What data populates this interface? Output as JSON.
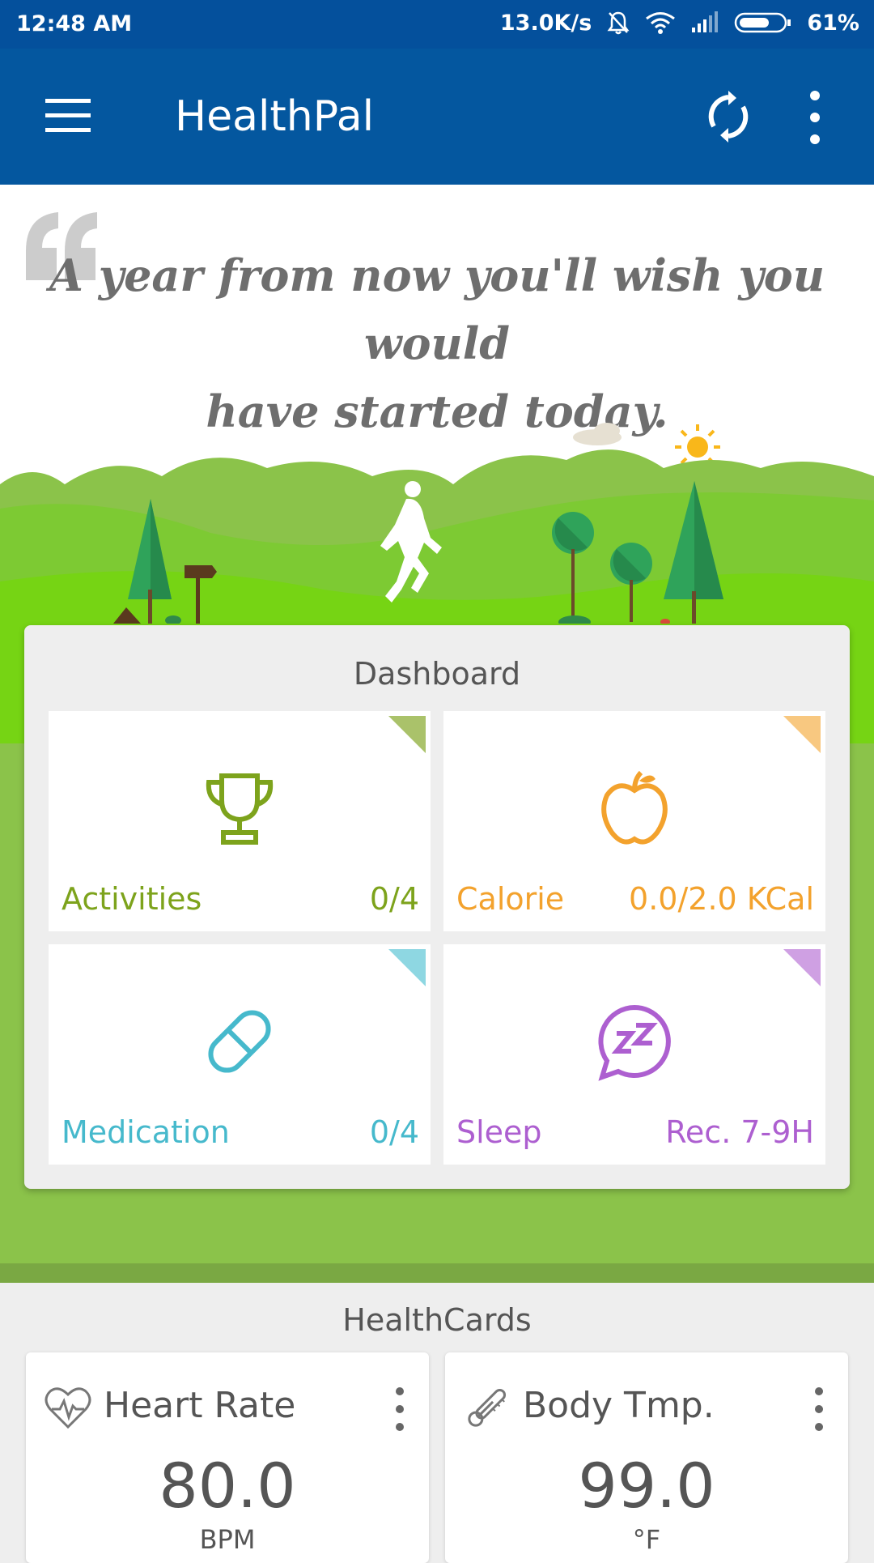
{
  "status_bar": {
    "time": "12:48 AM",
    "network_speed": "13.0K/s",
    "battery": "61%",
    "icons": [
      "mute-bell-icon",
      "wifi-icon",
      "signal-icon",
      "battery-icon"
    ]
  },
  "app_bar": {
    "title": "HealthPal",
    "icons": [
      "menu-icon",
      "sync-icon",
      "more-vert-icon"
    ]
  },
  "quote": {
    "line1": "A year from now you'll wish you would",
    "line2": "have started today."
  },
  "dashboard": {
    "title": "Dashboard",
    "tiles": [
      {
        "label": "Activities",
        "value": "0/4",
        "icon": "trophy-icon",
        "color": "#7da31c",
        "corner": "#aac26a"
      },
      {
        "label": "Calorie",
        "value": "0.0/2.0 KCal",
        "icon": "apple-icon",
        "color": "#f3a22d",
        "corner": "#f8c880"
      },
      {
        "label": "Medication",
        "value": "0/4",
        "icon": "pill-icon",
        "color": "#46b9cc",
        "corner": "#8ed7e2"
      },
      {
        "label": "Sleep",
        "value": "Rec. 7-9H",
        "icon": "sleep-icon",
        "color": "#ad5fd0",
        "corner": "#cfa0e3"
      }
    ]
  },
  "healthcards": {
    "title": "HealthCards",
    "cards": [
      {
        "name": "Heart Rate",
        "value": "80.0",
        "unit": "BPM",
        "icon": "heart-rate-icon"
      },
      {
        "name": "Body Tmp.",
        "value": "99.0",
        "unit": "°F",
        "icon": "thermometer-icon"
      }
    ]
  },
  "colors": {
    "primary": "#04579f",
    "status_bar": "#04509c",
    "green": "#76d414",
    "green_dark": "#8bc34a"
  }
}
